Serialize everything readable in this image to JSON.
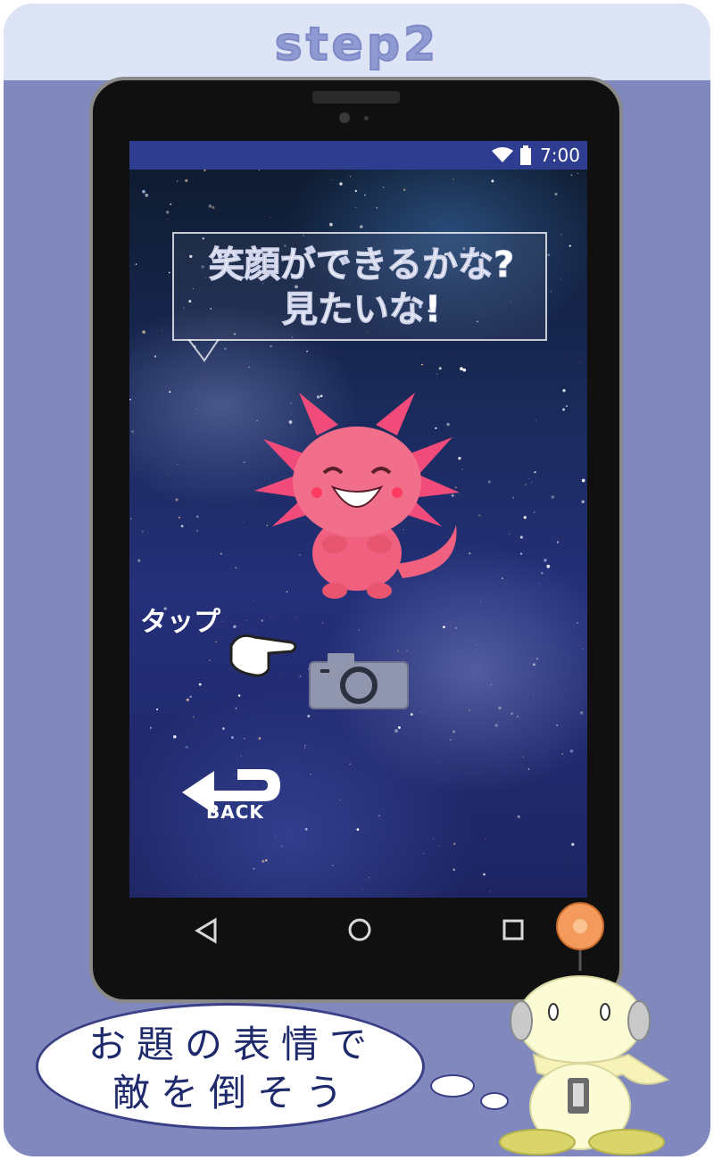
{
  "header": {
    "step_label": "step2"
  },
  "status_bar": {
    "time": "7:00",
    "icons": [
      "wifi-icon",
      "battery-icon"
    ]
  },
  "game": {
    "speech_lines": [
      "笑顔ができるかな?",
      "見たいな!"
    ],
    "tap_hint": "タップ",
    "back_label": "BACK",
    "icons": [
      "camera-icon",
      "pointing-hand-icon",
      "back-arrow-icon"
    ]
  },
  "nav_bar": {
    "icons": [
      "back-triangle-icon",
      "home-circle-icon",
      "recents-square-icon"
    ]
  },
  "instruction": {
    "lines": [
      "お題の表情で",
      "敵を倒そう"
    ]
  },
  "colors": {
    "header_bg": "#dce4f6",
    "card_bg": "#8088bd",
    "status_bar": "#2f3d91",
    "axolotl": "#f0607f",
    "speech_text": "#1e2a6b"
  }
}
